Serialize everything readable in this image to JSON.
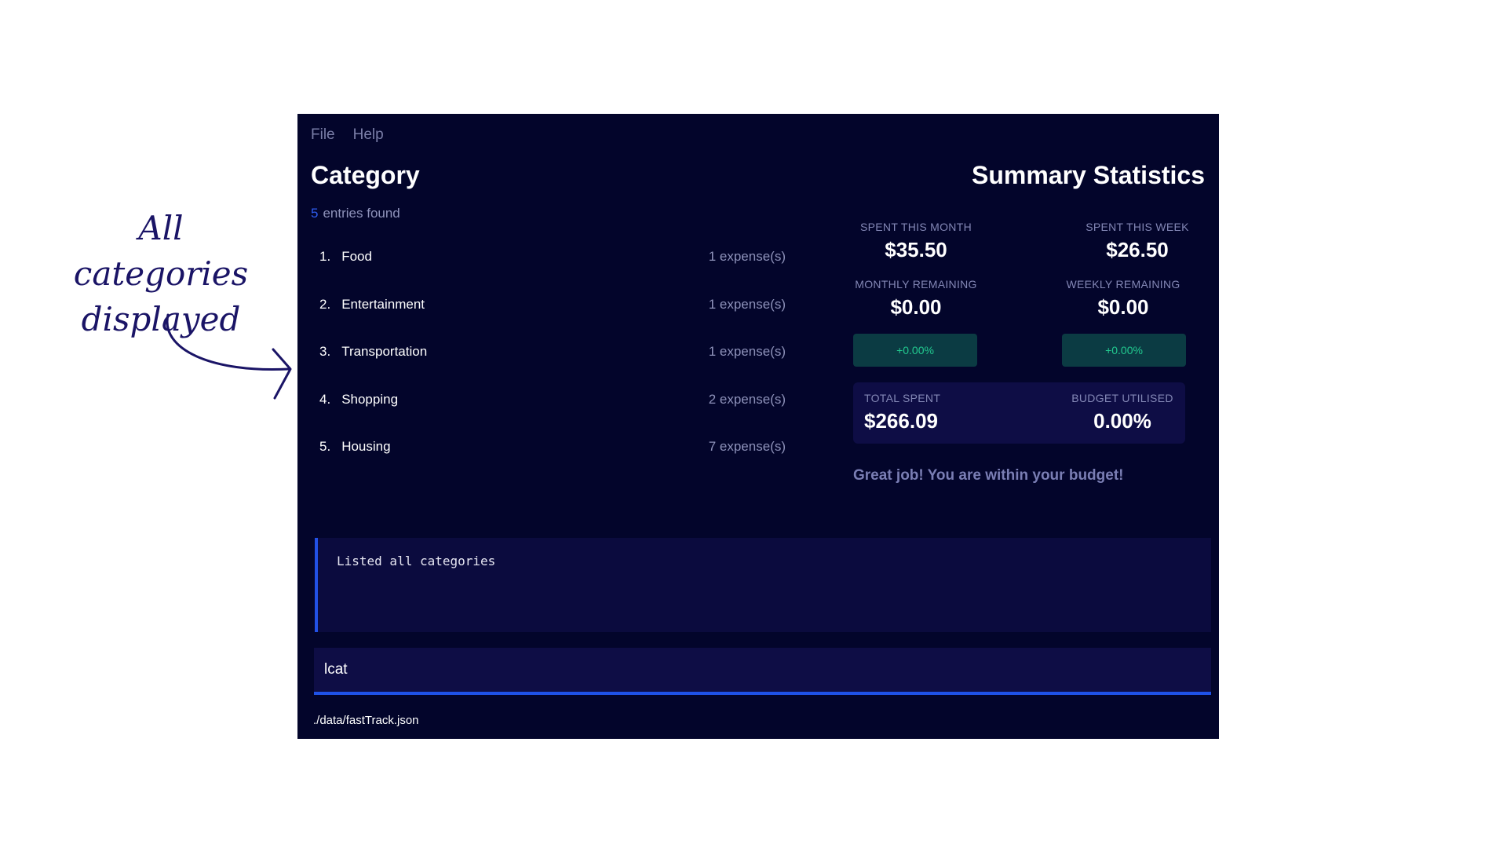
{
  "annotation": {
    "line1": "All categories",
    "line2": "displayed",
    "color": "#1a1466"
  },
  "menu": {
    "file": "File",
    "help": "Help"
  },
  "category": {
    "title": "Category",
    "entries_count": "5",
    "entries_text": "entries found",
    "items": [
      {
        "index": "1.",
        "name": "Food",
        "expenses": "1 expense(s)"
      },
      {
        "index": "2.",
        "name": "Entertainment",
        "expenses": "1 expense(s)"
      },
      {
        "index": "3.",
        "name": "Transportation",
        "expenses": "1 expense(s)"
      },
      {
        "index": "4.",
        "name": "Shopping",
        "expenses": "2 expense(s)"
      },
      {
        "index": "5.",
        "name": "Housing",
        "expenses": "7 expense(s)"
      }
    ]
  },
  "summary": {
    "title": "Summary Statistics",
    "spent_month_label": "SPENT THIS MONTH",
    "spent_month_value": "$35.50",
    "spent_week_label": "SPENT THIS WEEK",
    "spent_week_value": "$26.50",
    "monthly_remaining_label": "MONTHLY REMAINING",
    "monthly_remaining_value": "$0.00",
    "weekly_remaining_label": "WEEKLY REMAINING",
    "weekly_remaining_value": "$0.00",
    "monthly_change": "+0.00%",
    "weekly_change": "+0.00%",
    "total_spent_label": "TOTAL SPENT",
    "total_spent_value": "$266.09",
    "budget_utilised_label": "BUDGET UTILISED",
    "budget_utilised_value": "0.00%",
    "message": "Great job! You are within your budget!"
  },
  "result": {
    "text": "Listed all categories"
  },
  "command": {
    "value": "lcat"
  },
  "status": {
    "path": "./data/fastTrack.json"
  },
  "colors": {
    "background": "#03052b",
    "accent": "#1f52e8",
    "positive": "#22c98f"
  }
}
